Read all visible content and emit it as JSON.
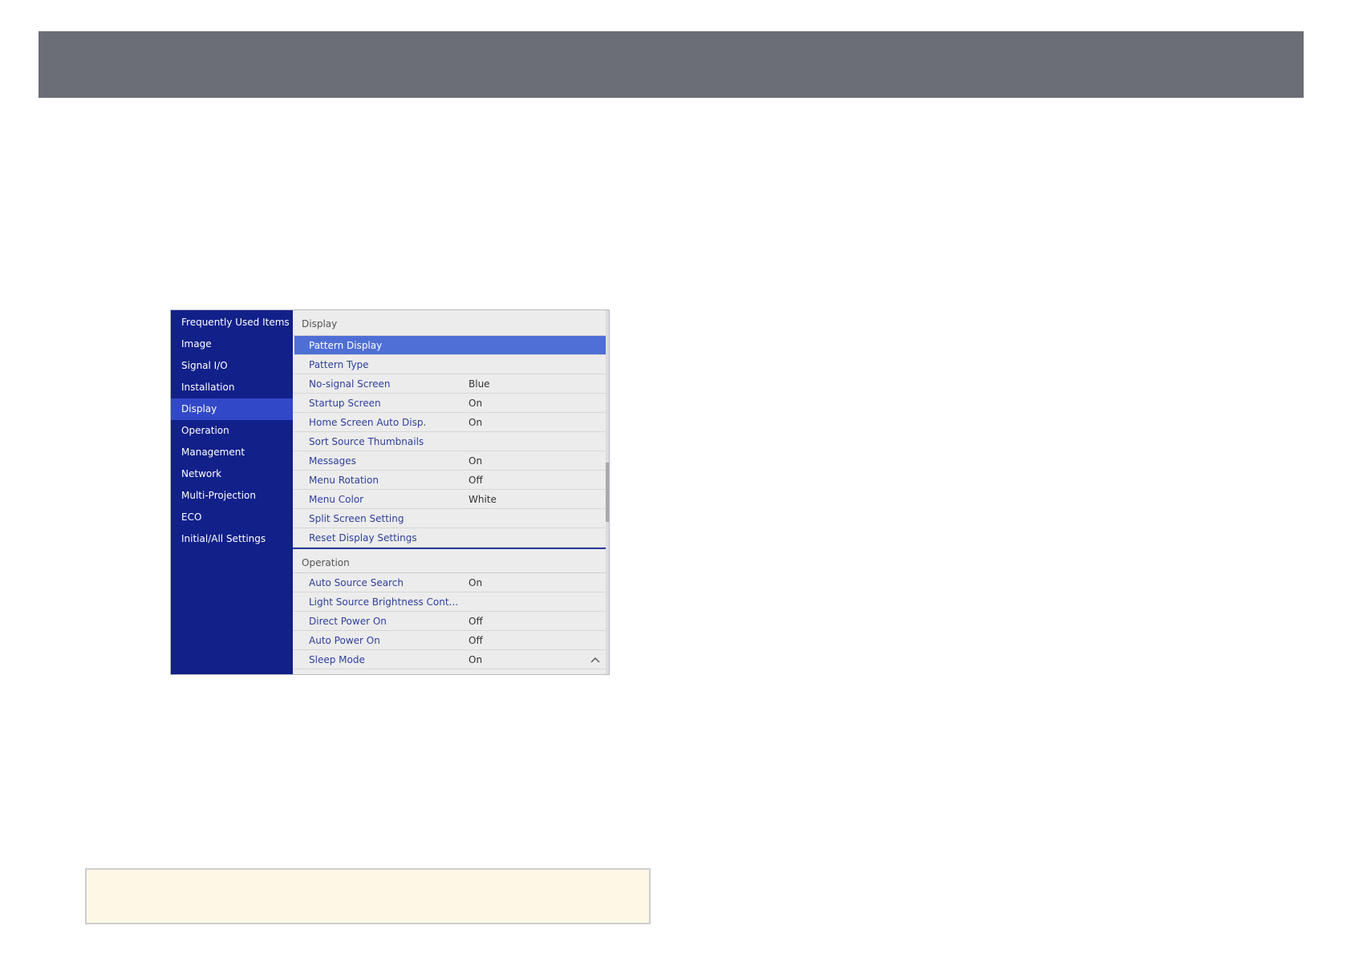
{
  "sidebar": {
    "items": [
      {
        "label": "Frequently Used Items"
      },
      {
        "label": "Image"
      },
      {
        "label": "Signal I/O"
      },
      {
        "label": "Installation"
      },
      {
        "label": "Display"
      },
      {
        "label": "Operation"
      },
      {
        "label": "Management"
      },
      {
        "label": "Network"
      },
      {
        "label": "Multi-Projection"
      },
      {
        "label": "ECO"
      },
      {
        "label": "Initial/All Settings"
      }
    ],
    "active_item": "Display"
  },
  "sections": {
    "display": {
      "header": "Display",
      "rows": [
        {
          "label": "Pattern Display",
          "value": ""
        },
        {
          "label": "Pattern Type",
          "value": ""
        },
        {
          "label": "No-signal Screen",
          "value": "Blue"
        },
        {
          "label": "Startup Screen",
          "value": "On"
        },
        {
          "label": "Home Screen Auto Disp.",
          "value": "On"
        },
        {
          "label": "Sort Source Thumbnails",
          "value": ""
        },
        {
          "label": "Messages",
          "value": "On"
        },
        {
          "label": "Menu Rotation",
          "value": "Off"
        },
        {
          "label": "Menu Color",
          "value": "White"
        },
        {
          "label": "Split Screen Setting",
          "value": ""
        },
        {
          "label": "Reset Display Settings",
          "value": ""
        }
      ]
    },
    "operation": {
      "header": "Operation",
      "rows": [
        {
          "label": "Auto Source Search",
          "value": "On"
        },
        {
          "label": "Light Source Brightness Cont...",
          "value": ""
        },
        {
          "label": "Direct Power On",
          "value": "Off"
        },
        {
          "label": "Auto Power On",
          "value": "Off"
        },
        {
          "label": "Sleep Mode",
          "value": "On"
        }
      ]
    }
  },
  "icons": {
    "chevron": "chevron-up-icon"
  },
  "colors": {
    "sidebar_bg": "#12208a",
    "sidebar_active": "#3148c8",
    "selected_row": "#4f6fd6",
    "label_text": "#2e3f9c",
    "top_bar": "#6b6e76",
    "note_bg": "#fdf8e6"
  }
}
